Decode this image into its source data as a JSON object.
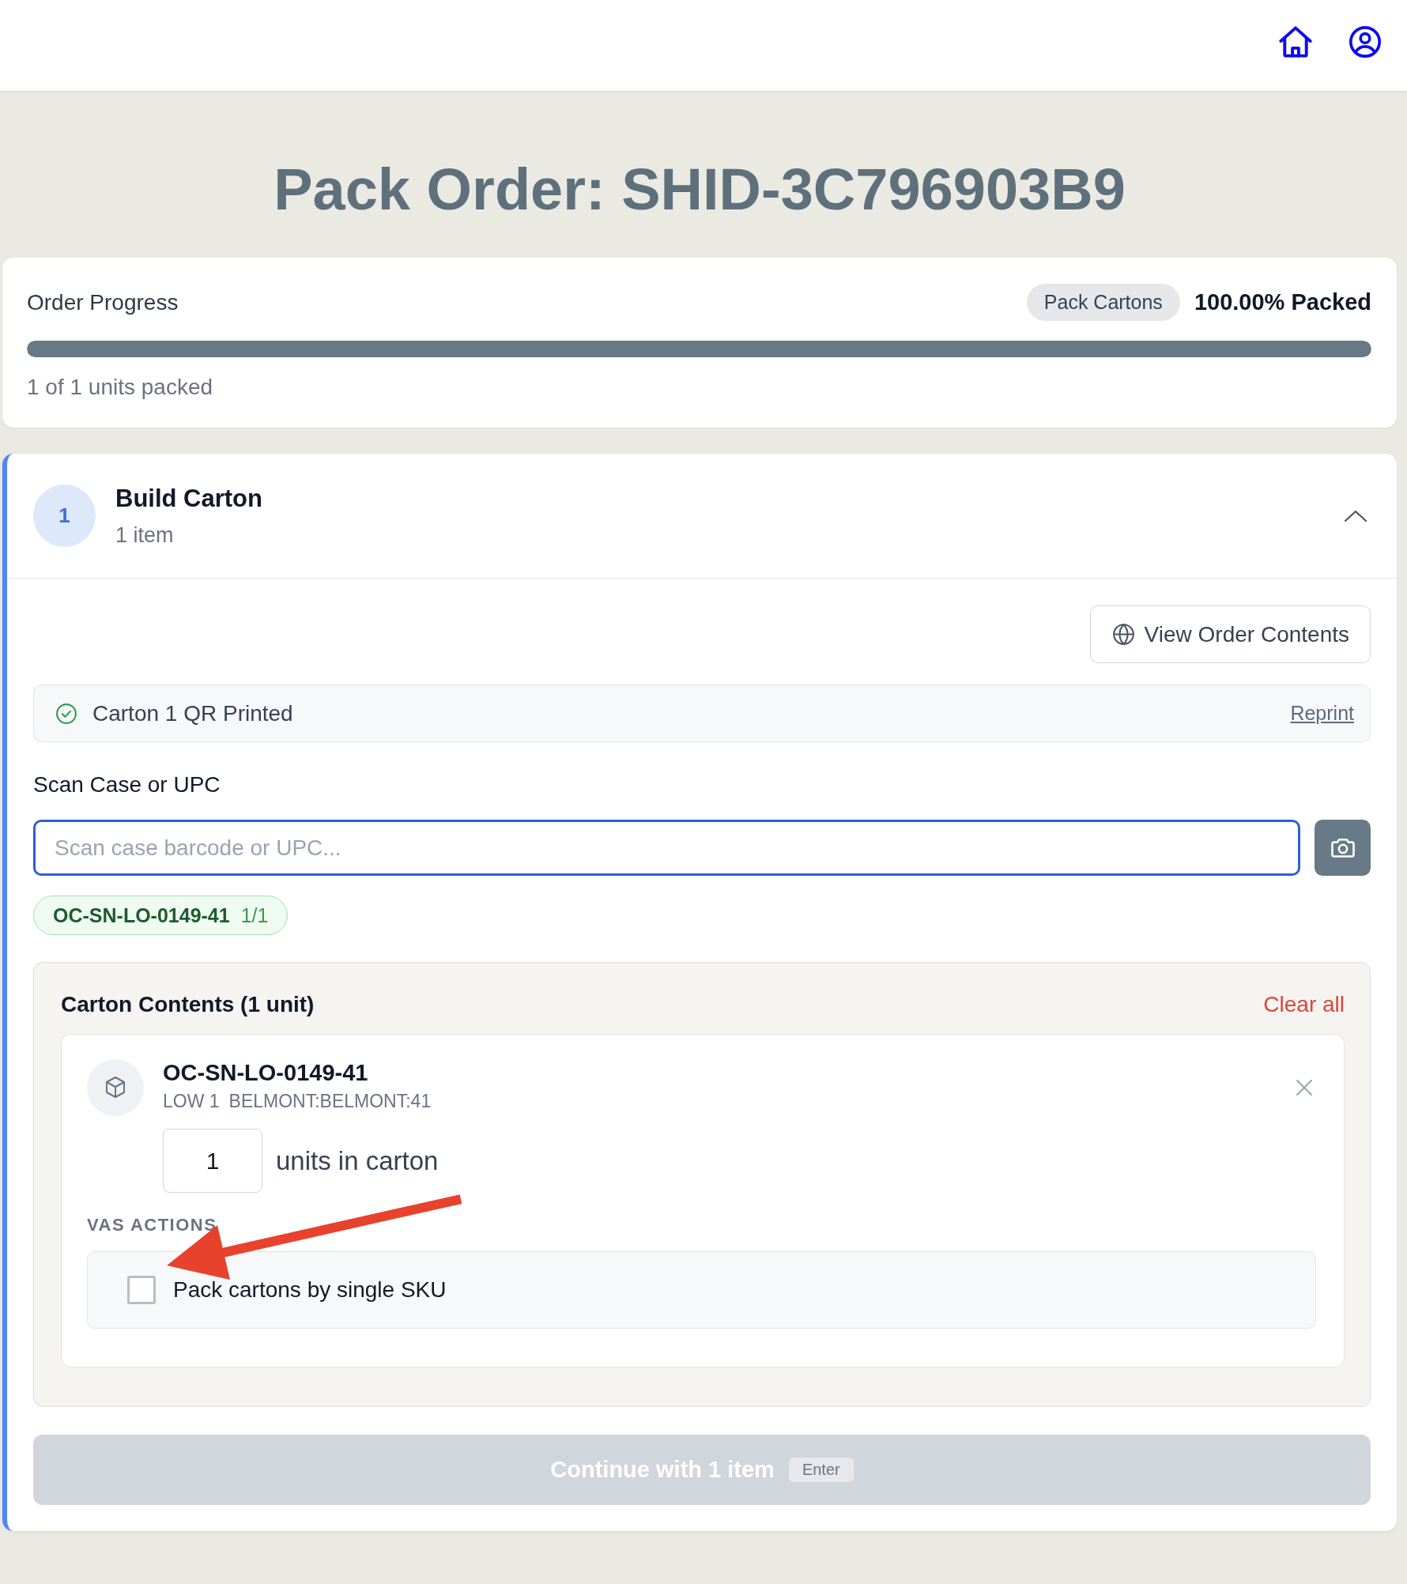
{
  "title": "Pack Order: SHID-3C796903B9",
  "progress": {
    "heading": "Order Progress",
    "stage": "Pack Cartons",
    "percent": "100.00% Packed",
    "level": 1,
    "summary": "1 of 1 units packed"
  },
  "section": {
    "step": "1",
    "title": "Build Carton",
    "subtitle": "1 item",
    "active": true,
    "expanded": true,
    "view_button": "View Order Contents",
    "qr_status": {
      "text": "Carton 1 QR Printed",
      "action": "Reprint"
    },
    "scan": {
      "label": "Scan Case or UPC",
      "placeholder": "Scan case barcode or UPC...",
      "focused": true
    },
    "scanned_tags": [
      {
        "code": "OC-SN-LO-0149-41",
        "count": "1/1"
      }
    ],
    "carton_contents": {
      "heading": "Carton Contents (1 unit)",
      "clear_action": "Clear all",
      "items": [
        {
          "sku": "OC-SN-LO-0149-41",
          "details": [
            "LOW 1",
            "BELMONT:BELMONT:41"
          ],
          "quantity": "1",
          "quantity_label": "units in carton",
          "vas_heading": "VAS ACTIONS",
          "vas_actions": [
            {
              "label": "Pack cartons by single SKU",
              "checked": false
            }
          ]
        }
      ]
    },
    "continue_button": {
      "label": "Continue with 1 item",
      "shortcut": "Enter",
      "disabled": true
    }
  },
  "annotations": [
    {
      "kind": "arrow"
    }
  ]
}
